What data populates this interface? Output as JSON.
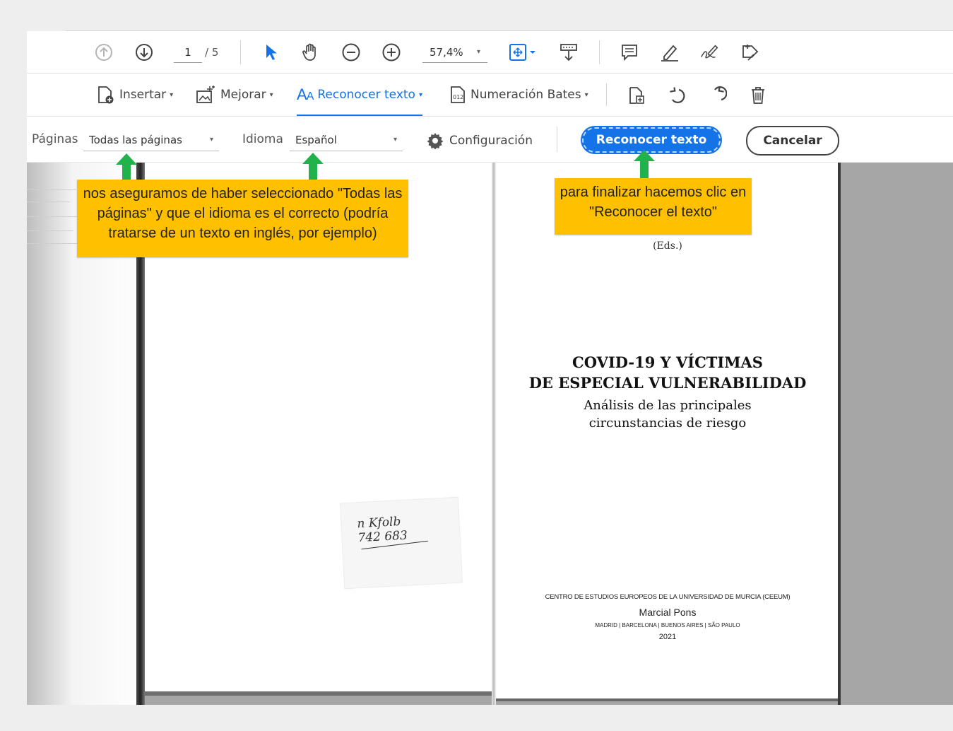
{
  "toolbar": {
    "page_current": "1",
    "page_total": "/ 5",
    "zoom": "57,4%",
    "zoom_caret": "▾"
  },
  "tools": {
    "insert_label": "Insertar",
    "enhance_label": "Mejorar",
    "ocr_label": "Reconocer texto",
    "bates_label": "Numeración Bates",
    "caret": "▾"
  },
  "ocr_bar": {
    "pages_label": "Páginas",
    "pages_value": "Todas las páginas",
    "language_label": "Idioma",
    "language_value": "Español",
    "settings_label": "Configuración",
    "recognize_button": "Reconocer texto",
    "cancel_button": "Cancelar",
    "caret": "▾"
  },
  "document": {
    "eds": "(Eds.)",
    "title_line1": "COVID-19 Y VÍCTIMAS",
    "title_line2": "DE ESPECIAL VULNERABILIDAD",
    "subtitle_line1": "Análisis de las principales",
    "subtitle_line2": "circunstancias de riesgo",
    "publisher_center": "CENTRO DE ESTUDIOS EUROPEOS DE LA UNIVERSIDAD DE MURCIA (CEEUM)",
    "publisher": "Marcial Pons",
    "cities": "MADRID  |  BARCELONA  |  BUENOS AIRES  |  SÃO PAULO",
    "year": "2021",
    "note_line1": "n Kfolb",
    "note_line2": "742 683"
  },
  "callouts": {
    "left_line1": "nos aseguramos de haber seleccionado \"Todas las",
    "left_line2": "páginas\" y que el idioma es el correcto (podría",
    "left_line3": "tratarse de un texto en inglés, por ejemplo)",
    "right_line1": "para finalizar hacemos clic en",
    "right_line2": "\"Reconocer el texto\""
  },
  "colors": {
    "accent": "#1473e6",
    "callout": "#ffc000",
    "arrow": "#22b24c"
  }
}
